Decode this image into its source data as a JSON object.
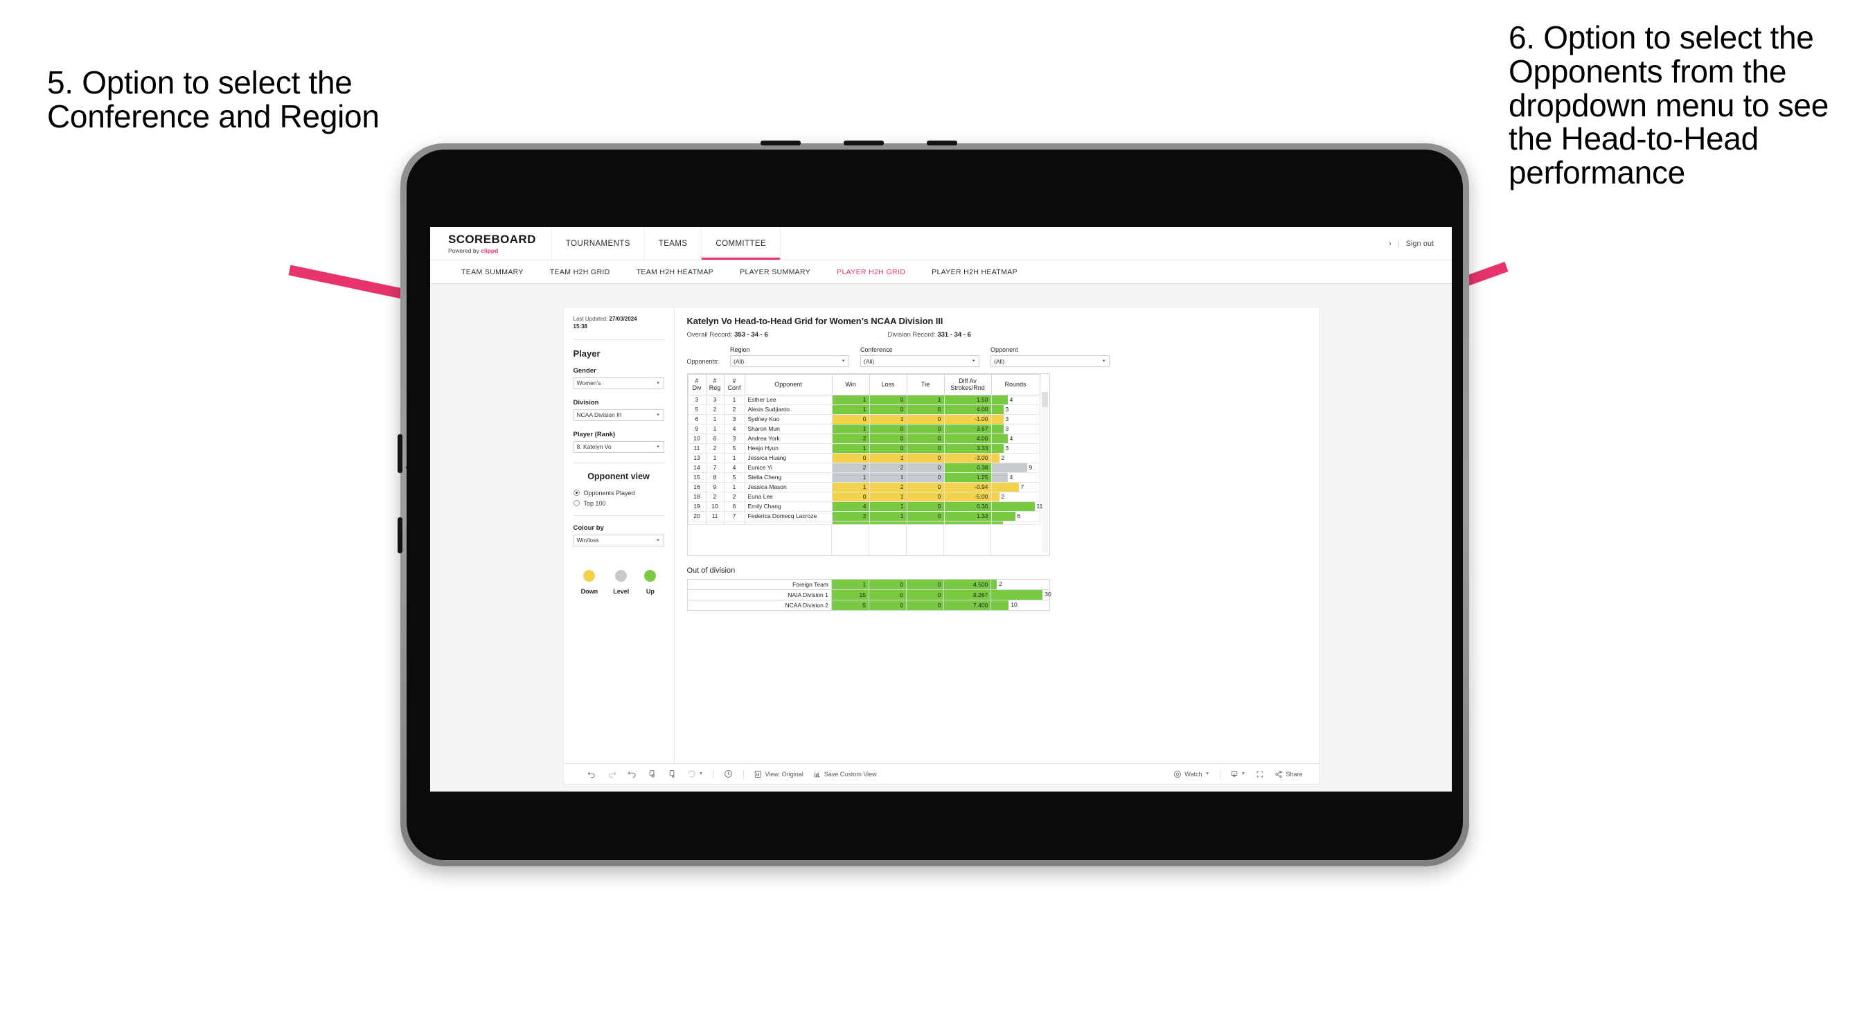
{
  "annotations": {
    "left": "5. Option to select the Conference and Region",
    "right": "6. Option to select the Opponents from the dropdown menu to see the Head-to-Head performance",
    "arrow_color": "#e8336d"
  },
  "app": {
    "brand": {
      "title": "SCOREBOARD",
      "powered_prefix": "Powered by ",
      "powered_name": "clippd"
    },
    "topnav": [
      {
        "label": "TOURNAMENTS",
        "active": false
      },
      {
        "label": "TEAMS",
        "active": false
      },
      {
        "label": "COMMITTEE",
        "active": true
      }
    ],
    "topnav_right": {
      "chevron": "›",
      "separator": "|",
      "signout": "Sign out"
    },
    "subnav": [
      {
        "label": "TEAM SUMMARY",
        "active": false
      },
      {
        "label": "TEAM H2H GRID",
        "active": false
      },
      {
        "label": "TEAM H2H HEATMAP",
        "active": false
      },
      {
        "label": "PLAYER SUMMARY",
        "active": false
      },
      {
        "label": "PLAYER H2H GRID",
        "active": true
      },
      {
        "label": "PLAYER H2H HEATMAP",
        "active": false
      }
    ],
    "accent_color": "#e8336d"
  },
  "sidebar": {
    "last_updated_label": "Last Updated: ",
    "last_updated_value": "27/03/2024",
    "last_updated_time": "15:38",
    "player_heading": "Player",
    "fields": [
      {
        "label": "Gender",
        "value": "Women’s"
      },
      {
        "label": "Division",
        "value": "NCAA Division III"
      },
      {
        "label": "Player (Rank)",
        "value": "8. Katelyn Vo"
      }
    ],
    "opponent_view": {
      "heading": "Opponent view",
      "options": [
        {
          "label": "Opponents Played",
          "selected": true
        },
        {
          "label": "Top 100",
          "selected": false
        }
      ]
    },
    "colour_by": {
      "label": "Colour by",
      "value": "Win/loss"
    },
    "legend": [
      {
        "label": "Down",
        "color": "#f2d24b"
      },
      {
        "label": "Level",
        "color": "#c6cacd"
      },
      {
        "label": "Up",
        "color": "#7ac943"
      }
    ]
  },
  "main": {
    "title": "Katelyn Vo Head-to-Head Grid for Women’s NCAA Division III",
    "overall_label": "Overall Record: ",
    "overall_value": "353 - 34 - 6",
    "division_label": "Division Record: ",
    "division_value": "331 -  34 - 6",
    "filters_lead": "Opponents:",
    "filters": [
      {
        "label": "Region",
        "value": "(All)"
      },
      {
        "label": "Conference",
        "value": "(All)"
      },
      {
        "label": "Opponent",
        "value": "(All)"
      }
    ],
    "out_of_division_title": "Out of division"
  },
  "chart_data": {
    "type": "table",
    "title": "Katelyn Vo Head-to-Head Grid for Women’s NCAA Division III",
    "columns": [
      "# Div",
      "# Reg",
      "# Conf",
      "Opponent",
      "Win",
      "Loss",
      "Tie",
      "Diff Av Strokes/Rnd",
      "Rounds"
    ],
    "column_headers_two_line": {
      "div": [
        "#",
        "Div"
      ],
      "reg": [
        "#",
        "Reg"
      ],
      "conf": [
        "#",
        "Conf"
      ],
      "opponent": [
        "Opponent"
      ],
      "win": [
        "Win"
      ],
      "loss": [
        "Loss"
      ],
      "tie": [
        "Tie"
      ],
      "diff": [
        "Diff Av",
        "Strokes/Rnd"
      ],
      "rounds": [
        "Rounds"
      ]
    },
    "colour_by": "Win/loss",
    "colour_scale": {
      "up": "#7ac943",
      "level": "#c6cacd",
      "down": "#f2d24b"
    },
    "rounds_max": 11,
    "rows": [
      {
        "div": "3",
        "reg": "3",
        "conf": "1",
        "opponent": "Esther Lee",
        "win": "1",
        "loss": "0",
        "tie": "1",
        "diff": "1.50",
        "rounds": 4,
        "status": "up",
        "rounds_status": "up"
      },
      {
        "div": "5",
        "reg": "2",
        "conf": "2",
        "opponent": "Alexis Sudjianto",
        "win": "1",
        "loss": "0",
        "tie": "0",
        "diff": "4.00",
        "rounds": 3,
        "status": "up",
        "rounds_status": "up"
      },
      {
        "div": "6",
        "reg": "1",
        "conf": "3",
        "opponent": "Sydney Kuo",
        "win": "0",
        "loss": "1",
        "tie": "0",
        "diff": "-1.00",
        "rounds": 3,
        "status": "down",
        "rounds_status": "down"
      },
      {
        "div": "9",
        "reg": "1",
        "conf": "4",
        "opponent": "Sharon Mun",
        "win": "1",
        "loss": "0",
        "tie": "0",
        "diff": "3.67",
        "rounds": 3,
        "status": "up",
        "rounds_status": "up"
      },
      {
        "div": "10",
        "reg": "6",
        "conf": "3",
        "opponent": "Andrea York",
        "win": "2",
        "loss": "0",
        "tie": "0",
        "diff": "4.00",
        "rounds": 4,
        "status": "up",
        "rounds_status": "up"
      },
      {
        "div": "11",
        "reg": "2",
        "conf": "5",
        "opponent": "Heejo Hyun",
        "win": "1",
        "loss": "0",
        "tie": "0",
        "diff": "3.33",
        "rounds": 3,
        "status": "up",
        "rounds_status": "up"
      },
      {
        "div": "13",
        "reg": "1",
        "conf": "1",
        "opponent": "Jessica Huang",
        "win": "0",
        "loss": "1",
        "tie": "0",
        "diff": "-3.00",
        "rounds": 2,
        "status": "down",
        "rounds_status": "down"
      },
      {
        "div": "14",
        "reg": "7",
        "conf": "4",
        "opponent": "Eunice Yi",
        "win": "2",
        "loss": "2",
        "tie": "0",
        "diff": "0.38",
        "rounds": 9,
        "status": "level",
        "diff_status": "up",
        "rounds_status": "level"
      },
      {
        "div": "15",
        "reg": "8",
        "conf": "5",
        "opponent": "Stella Cheng",
        "win": "1",
        "loss": "1",
        "tie": "0",
        "diff": "1.25",
        "rounds": 4,
        "status": "level",
        "diff_status": "up",
        "rounds_status": "level"
      },
      {
        "div": "16",
        "reg": "9",
        "conf": "1",
        "opponent": "Jessica Mason",
        "win": "1",
        "loss": "2",
        "tie": "0",
        "diff": "-0.94",
        "rounds": 7,
        "status": "down",
        "rounds_status": "down"
      },
      {
        "div": "18",
        "reg": "2",
        "conf": "2",
        "opponent": "Euna Lee",
        "win": "0",
        "loss": "1",
        "tie": "0",
        "diff": "-5.00",
        "rounds": 2,
        "status": "down",
        "rounds_status": "down"
      },
      {
        "div": "19",
        "reg": "10",
        "conf": "6",
        "opponent": "Emily Chang",
        "win": "4",
        "loss": "1",
        "tie": "0",
        "diff": "0.30",
        "rounds": 11,
        "status": "up",
        "rounds_status": "up"
      },
      {
        "div": "20",
        "reg": "11",
        "conf": "7",
        "opponent": "Federica Domecq Lacroze",
        "win": "2",
        "loss": "1",
        "tie": "0",
        "diff": "1.33",
        "rounds": 6,
        "status": "up",
        "rounds_status": "up"
      }
    ],
    "out_of_division": {
      "title": "Out of division",
      "rounds_max": 30,
      "rows": [
        {
          "label": "Foreign Team",
          "win": "1",
          "loss": "0",
          "tie": "0",
          "diff": "4.500",
          "rounds": 2,
          "status": "up"
        },
        {
          "label": "NAIA Division 1",
          "win": "15",
          "loss": "0",
          "tie": "0",
          "diff": "9.267",
          "rounds": 30,
          "status": "up"
        },
        {
          "label": "NCAA Division 2",
          "win": "5",
          "loss": "0",
          "tie": "0",
          "diff": "7.400",
          "rounds": 10,
          "status": "up"
        }
      ]
    }
  },
  "toolbar": {
    "items": [
      {
        "name": "undo-icon",
        "label": ""
      },
      {
        "name": "redo-icon",
        "label": ""
      },
      {
        "name": "revert-icon",
        "label": ""
      },
      {
        "name": "refresh-data-icon",
        "label": ""
      },
      {
        "name": "pause-updates-icon",
        "label": ""
      },
      {
        "name": "reset-dropdown-icon",
        "label": ""
      },
      {
        "name": "alerts-icon",
        "label": ""
      },
      {
        "name": "view-original-button",
        "label": "View: Original"
      },
      {
        "name": "save-custom-view-button",
        "label": "Save Custom View"
      },
      {
        "name": "watch-button",
        "label": "Watch"
      },
      {
        "name": "download-button",
        "label": ""
      },
      {
        "name": "fullscreen-button",
        "label": ""
      },
      {
        "name": "share-button",
        "label": "Share"
      }
    ],
    "view_original": "View: Original",
    "save_custom_view": "Save Custom View",
    "watch": "Watch",
    "share": "Share"
  }
}
